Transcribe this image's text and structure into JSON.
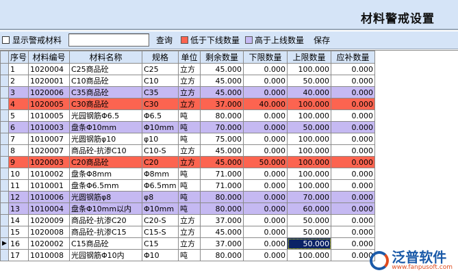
{
  "title": "材料警戒设置",
  "toolbar": {
    "show_alert_label": "显示警戒材料",
    "search_value": "",
    "query_label": "查询",
    "low_legend": "低于下线数量",
    "high_legend": "高于上线数量",
    "save_label": "保存",
    "low_color": "#fc6450",
    "high_color": "#c5b9f2"
  },
  "columns": [
    "序号",
    "材料编号",
    "材料名称",
    "规格",
    "单位",
    "剩余数量",
    "下限数量",
    "上限数量",
    "应补数量"
  ],
  "rows": [
    [
      "1",
      "1020004",
      "C25商品砼",
      "C25",
      "立方",
      "45.000",
      "0.000",
      "100.000",
      "0.000",
      ""
    ],
    [
      "2",
      "1020001",
      "C10商品砼",
      "C10",
      "立方",
      "45.000",
      "0.000",
      "50.000",
      "0.000",
      ""
    ],
    [
      "3",
      "1020006",
      "C35商品砼",
      "C35",
      "立方",
      "45.000",
      "0.000",
      "40.000",
      "0.000",
      "high"
    ],
    [
      "4",
      "1020005",
      "C30商品砼",
      "C30",
      "立方",
      "37.000",
      "40.000",
      "100.000",
      "0.000",
      "low"
    ],
    [
      "5",
      "1010005",
      "光园钢筋Φ6.5",
      "Φ6.5",
      "吨",
      "80.000",
      "0.000",
      "100.000",
      "0.000",
      ""
    ],
    [
      "6",
      "1010003",
      "盘条Φ10mm",
      "Φ10mm",
      "吨",
      "70.000",
      "0.000",
      "50.000",
      "0.000",
      "high"
    ],
    [
      "7",
      "1010007",
      "光圆钢筋φ10",
      "φ10",
      "吨",
      "75.000",
      "0.000",
      "100.000",
      "0.000",
      ""
    ],
    [
      "8",
      "1020007",
      "商品砼-抗渗C10",
      "C10-S",
      "立方",
      "45.000",
      "0.000",
      "100.000",
      "0.000",
      ""
    ],
    [
      "9",
      "1020003",
      "C20商品砼",
      "C20",
      "立方",
      "45.000",
      "50.000",
      "100.000",
      "0.000",
      "low"
    ],
    [
      "10",
      "1010002",
      "盘条Φ8mm",
      "Φ8mm",
      "吨",
      "71.000",
      "0.000",
      "100.000",
      "0.000",
      ""
    ],
    [
      "11",
      "1010001",
      "盘条Φ6.5mm",
      "Φ6.5mm",
      "吨",
      "71.000",
      "0.000",
      "100.000",
      "0.000",
      ""
    ],
    [
      "12",
      "1010006",
      "光圆钢筋φ8",
      "φ8",
      "吨",
      "80.000",
      "0.000",
      "70.000",
      "0.000",
      "high"
    ],
    [
      "13",
      "1010004",
      "盘条Φ10mm以内",
      "Φ10mm",
      "吨",
      "80.000",
      "0.000",
      "60.000",
      "0.000",
      "high"
    ],
    [
      "14",
      "1020009",
      "商品砼-抗渗C20",
      "C20-S",
      "立方",
      "37.000",
      "0.000",
      "50.000",
      "0.000",
      ""
    ],
    [
      "15",
      "1020008",
      "商品砼-抗渗C15",
      "C15-S",
      "立方",
      "45.000",
      "0.000",
      "50.000",
      "0.000",
      ""
    ],
    [
      "16",
      "1020002",
      "C15商品砼",
      "C15",
      "立方",
      "37.000",
      "0.000",
      "50.000",
      "0.000",
      ""
    ],
    [
      "17",
      "1010008",
      "光园钢筋Φ10内",
      "Φ10",
      "吨",
      "80.000",
      "0.000",
      "100.000",
      "0.000",
      ""
    ]
  ],
  "current_row": "16",
  "logo": {
    "name": "泛普软件",
    "url": "www.fanpusoft.com"
  }
}
